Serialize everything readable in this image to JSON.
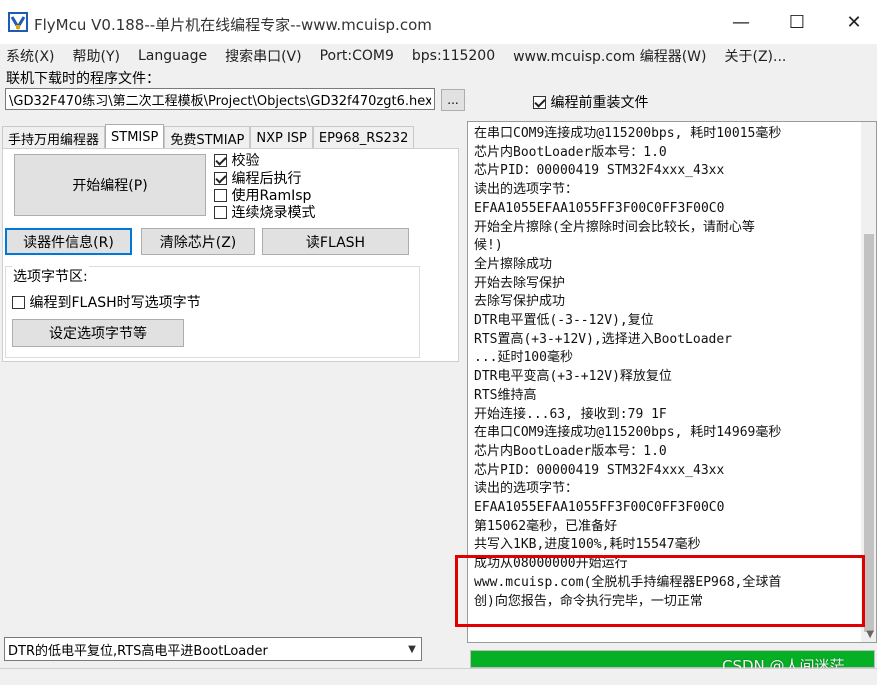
{
  "window": {
    "title": "FlyMcu V0.188--单片机在线编程专家--www.mcuisp.com",
    "minimize": "—",
    "maximize": "☐",
    "close": "✕"
  },
  "menu": [
    "系统(X)",
    "帮助(Y)",
    "Language",
    "搜索串口(V)",
    "Port:COM9",
    "bps:115200",
    "www.mcuisp.com 编程器(W)",
    "关于(Z)..."
  ],
  "file": {
    "label": "联机下载时的程序文件：",
    "path": "\\GD32F470练习\\第二次工程模板\\Project\\Objects\\GD32f470zgt6.hex",
    "browse_label": "...",
    "reload_label": "编程前重装文件",
    "reload_checked": true
  },
  "tabs": [
    "手持万用编程器",
    "STMISP",
    "免费STMIAP",
    "NXP ISP",
    "EP968_RS232"
  ],
  "active_tab": 1,
  "program": {
    "start_label": "开始编程(P)",
    "options": [
      {
        "label": "校验",
        "checked": true
      },
      {
        "label": "编程后执行",
        "checked": true
      },
      {
        "label": "使用RamIsp",
        "checked": false
      },
      {
        "label": "连续烧录模式",
        "checked": false
      }
    ],
    "read_info_label": "读器件信息(R)",
    "erase_label": "清除芯片(Z)",
    "read_flash_label": "读FLASH"
  },
  "option_bytes": {
    "group_label": "选项字节区:",
    "write_label": "编程到FLASH时写选项字节",
    "write_checked": false,
    "set_label": "设定选项字节等"
  },
  "dtr_mode": "DTR的低电平复位,RTS高电平进BootLoader",
  "log": [
    "在串口COM9连接成功@115200bps, 耗时10015毫秒",
    "芯片内BootLoader版本号：1.0",
    "芯片PID：00000419  STM32F4xxx_43xx",
    "读出的选项字节：",
    "EFAA1055EFAA1055FF3F00C0FF3F00C0",
    "开始全片擦除(全片擦除时间会比较长，请耐心等",
    "候!)",
    "全片擦除成功",
    "开始去除写保护",
    "去除写保护成功",
    "DTR电平置低(-3--12V),复位",
    "RTS置高(+3-+12V),选择进入BootLoader",
    "...延时100毫秒",
    "DTR电平变高(+3-+12V)释放复位",
    "RTS维持高",
    "开始连接...63, 接收到:79 1F",
    "在串口COM9连接成功@115200bps, 耗时14969毫秒",
    "芯片内BootLoader版本号：1.0",
    "芯片PID：00000419  STM32F4xxx_43xx",
    "读出的选项字节：",
    "EFAA1055EFAA1055FF3F00C0FF3F00C0",
    "第15062毫秒，已准备好",
    "共写入1KB,进度100%,耗时15547毫秒",
    "成功从08000000开始运行",
    "www.mcuisp.com(全脱机手持编程器EP968,全球首",
    "创)向您报告，命令执行完毕，一切正常"
  ],
  "progress": 1.0,
  "watermark": "CSDN @人间迷茫",
  "colors": {
    "progress": "#06b025",
    "highlight": "#e00000",
    "focus": "#0078d7"
  },
  "icons": {
    "app": "flymcu-logo-icon"
  }
}
